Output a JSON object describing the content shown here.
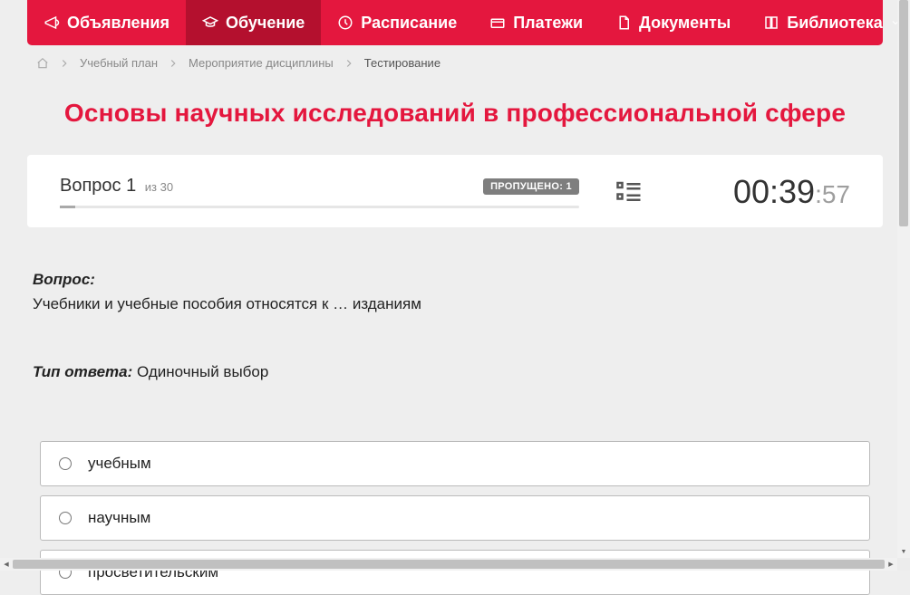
{
  "nav": {
    "items": [
      {
        "label": "Объявления",
        "icon": "announce",
        "active": false
      },
      {
        "label": "Обучение",
        "icon": "education",
        "active": true
      },
      {
        "label": "Расписание",
        "icon": "schedule",
        "active": false
      },
      {
        "label": "Платежи",
        "icon": "payments",
        "active": false
      },
      {
        "label": "Документы",
        "icon": "documents",
        "active": false
      },
      {
        "label": "Библиотека",
        "icon": "library",
        "active": false,
        "dropdown": true
      }
    ]
  },
  "breadcrumb": {
    "items": [
      {
        "label": "Учебный план",
        "link": true
      },
      {
        "label": "Мероприятие дисциплины",
        "link": true
      },
      {
        "label": "Тестирование",
        "link": false
      }
    ]
  },
  "page_title": "Основы научных исследований в профессиональной сфере",
  "question_panel": {
    "question_word": "Вопрос",
    "current": "1",
    "of_word": "из",
    "total": "30",
    "skipped_label": "ПРОПУЩЕНО: 1",
    "progress_percent": 3
  },
  "timer": {
    "mm": "00",
    "ss": "39",
    "ms": "57"
  },
  "question": {
    "label": "Вопрос:",
    "text": "Учебники и учебные пособия относятся к … изданиям"
  },
  "answer_type": {
    "label": "Тип ответа:",
    "value": "Одиночный выбор"
  },
  "answers": [
    {
      "text": "учебным"
    },
    {
      "text": "научным"
    },
    {
      "text": "просветительским"
    }
  ]
}
